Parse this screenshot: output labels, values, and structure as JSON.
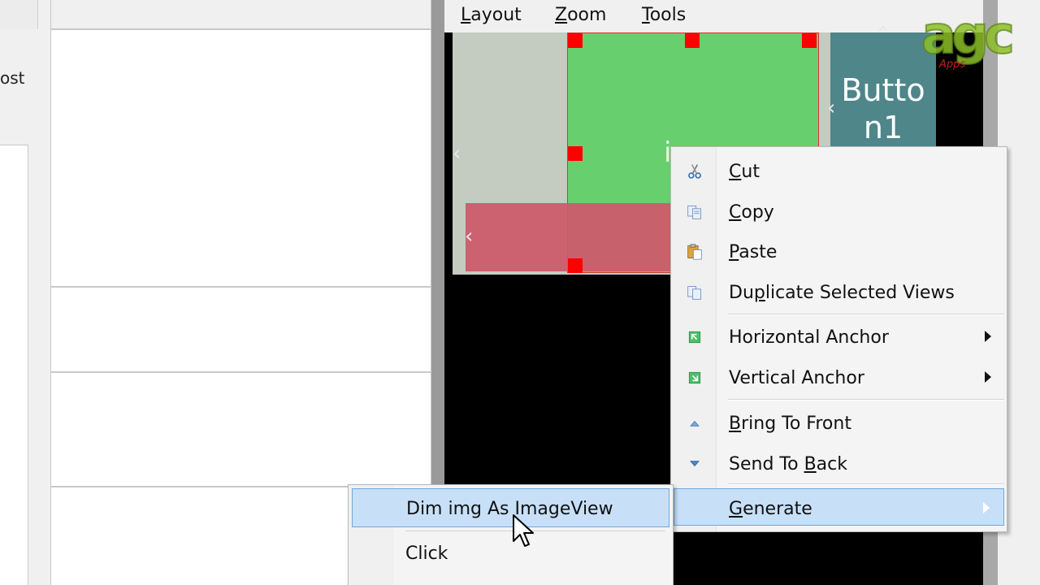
{
  "left_panel": {
    "clipped_text": "ost"
  },
  "menubar": {
    "items": [
      {
        "mnemonic": "L",
        "rest": "ayout"
      },
      {
        "mnemonic": "Z",
        "rest": "oom"
      },
      {
        "mnemonic": "T",
        "rest": "ools"
      }
    ]
  },
  "designer": {
    "button_label_line1": "Butto",
    "button_label_line2": "n1",
    "green_view_letter": "i",
    "colors": {
      "gray_panel": "#c4cbc1",
      "green_view": "#68cf6e",
      "pink_view": "#cc5b6c",
      "button_view": "#4e868a",
      "selection_handle": "#ff0000"
    }
  },
  "logo": {
    "text": "agc",
    "subtext": "Apps"
  },
  "context_menu": {
    "items": [
      {
        "pre": "",
        "mn": "C",
        "post": "ut",
        "icon": "scissors-icon"
      },
      {
        "pre": "",
        "mn": "C",
        "post": "opy",
        "icon": "copy-icon"
      },
      {
        "pre": "",
        "mn": "P",
        "post": "aste",
        "icon": "paste-icon"
      },
      {
        "pre": "Du",
        "mn": "p",
        "post": "licate Selected Views",
        "icon": "duplicate-icon"
      },
      {
        "pre": "Horizontal Anchor",
        "mn": "",
        "post": "",
        "icon": "horizontal-anchor-icon"
      },
      {
        "pre": "Vertical Anchor",
        "mn": "",
        "post": "",
        "icon": "vertical-anchor-icon"
      },
      {
        "pre": "",
        "mn": "B",
        "post": "ring To Front",
        "icon": "bring-to-front-icon"
      },
      {
        "pre": "Send To ",
        "mn": "B",
        "post": "ack",
        "icon": "send-to-back-icon"
      },
      {
        "pre": "",
        "mn": "G",
        "post": "enerate",
        "icon": ""
      }
    ]
  },
  "submenu": {
    "items": [
      {
        "label": "Dim img As ImageView"
      },
      {
        "label": "Click"
      }
    ]
  }
}
